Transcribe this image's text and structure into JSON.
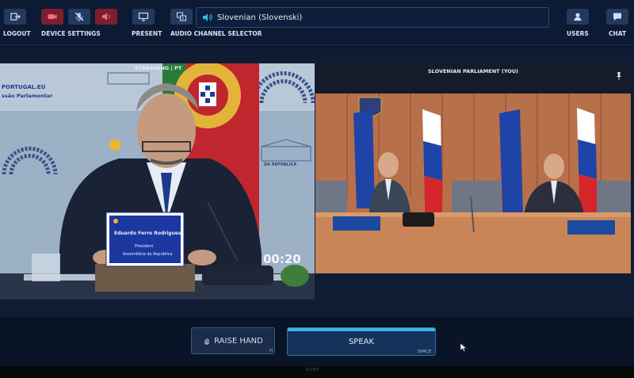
{
  "toolbar": {
    "logout": {
      "label": "LOGOUT",
      "icon": "logout-icon"
    },
    "device_settings": {
      "label": "DEVICE SETTINGS",
      "icons": [
        "camera-off-icon",
        "mic-off-icon",
        "speaker-icon"
      ]
    },
    "present": {
      "label": "PRESENT",
      "icon": "monitor-icon"
    },
    "audio_channel_selector": {
      "label": "AUDIO CHANNEL SELECTOR",
      "icon": "language-icon"
    },
    "channel": {
      "value": "Slovenian (Slovenski)",
      "icon": "speaker-icon"
    },
    "users": {
      "label": "USERS",
      "icon": "users-icon"
    },
    "chat": {
      "label": "CHAT",
      "icon": "chat-icon"
    }
  },
  "feeds": {
    "left": {
      "badge": "STREAMING | PT",
      "logo_text": "PORTUGAL.EU",
      "subtitle": "ssão Parlamentar",
      "side_caption": "DA REPÚBLICA",
      "nameplate": {
        "name": "Eduardo Ferro Rodrigues",
        "role": "President",
        "org": "Assembleia da República"
      },
      "timer": "00:20"
    },
    "right": {
      "title": "SLOVENIAN PARLIAMENT (YOU)",
      "pin_icon": "pin-icon"
    }
  },
  "controls": {
    "raise_hand": {
      "label": "RAISE HAND",
      "shortcut": "H",
      "icon": "hand-icon"
    },
    "speak": {
      "label": "SPEAK",
      "shortcut": "SPACE"
    }
  },
  "bezel_brand": "SONY",
  "colors": {
    "accent": "#39b6e6",
    "danger": "#7a1f2e",
    "panel": "#233a5e"
  }
}
